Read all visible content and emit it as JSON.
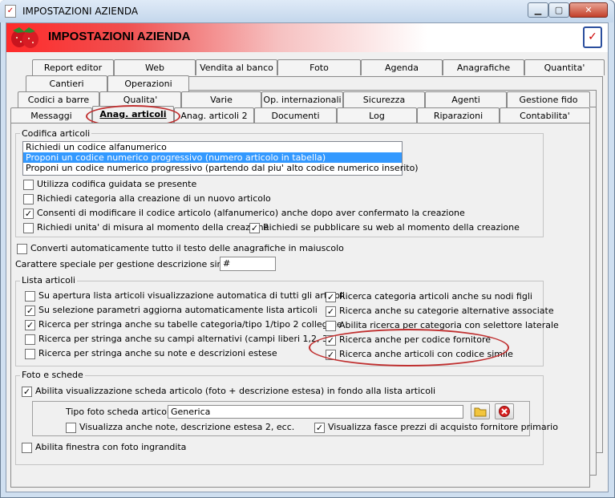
{
  "window": {
    "title": "IMPOSTAZIONI AZIENDA"
  },
  "header": {
    "title": "IMPOSTAZIONI AZIENDA"
  },
  "tabs": {
    "row1": [
      "Report editor",
      "Web",
      "Vendita al banco",
      "Foto",
      "Agenda",
      "Anagrafiche",
      "Quantita'"
    ],
    "row2": [
      "Cantieri",
      "Operazioni"
    ],
    "row3": [
      "Codici a barre",
      "Qualita'",
      "Varie",
      "Op. internazionali",
      "Sicurezza",
      "Agenti",
      "Gestione fido"
    ],
    "row4": [
      "Messaggi",
      "Anag. articoli",
      "Anag. articoli 2",
      "Documenti",
      "Log",
      "Riparazioni",
      "Contabilita'"
    ]
  },
  "codifica": {
    "title": "Codifica articoli",
    "options": [
      "Richiedi un codice alfanumerico",
      "Proponi un codice numerico progressivo (numero articolo in tabella)",
      "Proponi un codice numerico progressivo (partendo dal piu' alto codice numerico inserito)"
    ],
    "checks": [
      {
        "label": "Utilizza codifica guidata se presente",
        "checked": false
      },
      {
        "label": "Richiedi categoria alla creazione di un nuovo articolo",
        "checked": false
      },
      {
        "label": "Consenti di modificare il codice articolo (alfanumerico) anche dopo aver confermato la creazione",
        "checked": true
      },
      {
        "label": "Richiedi unita' di misura al momento della creazione",
        "checked": false
      },
      {
        "label": "Richiedi se pubblicare su web al momento della creazione",
        "checked": true
      }
    ]
  },
  "converti": {
    "label": "Converti automaticamente tutto il testo delle anagrafiche in maiuscolo",
    "checked": false
  },
  "carattere": {
    "label": "Carattere speciale per gestione descrizione sintetica :",
    "value": "#"
  },
  "lista": {
    "title": "Lista articoli",
    "left": [
      {
        "label": "Su apertura lista articoli visualizzazione automatica di tutti gli articoli",
        "checked": false
      },
      {
        "label": "Su selezione parametri aggiorna automaticamente lista articoli",
        "checked": true
      },
      {
        "label": "Ricerca per stringa anche su tabelle categoria/tipo 1/tipo 2 collegate",
        "checked": true
      },
      {
        "label": "Ricerca per stringa anche su campi alternativi (campi liberi 1,2, 3)",
        "checked": false
      },
      {
        "label": "Ricerca per stringa anche su note e descrizioni estese",
        "checked": false
      }
    ],
    "right": [
      {
        "label": "Ricerca categoria articoli anche su nodi figli",
        "checked": true
      },
      {
        "label": "Ricerca anche su categorie alternative associate",
        "checked": true
      },
      {
        "label": "Abilita ricerca per categoria con selettore laterale",
        "checked": false
      },
      {
        "label": "Ricerca anche per codice fornitore",
        "checked": true
      },
      {
        "label": "Ricerca anche articoli con codice simile",
        "checked": true
      }
    ]
  },
  "foto": {
    "title": "Foto e schede",
    "abilita": {
      "label": "Abilita visualizzazione scheda articolo (foto + descrizione estesa) in fondo alla lista articoli",
      "checked": true
    },
    "tipo_label": "Tipo foto scheda articolo :",
    "tipo_value": "Generica",
    "note": {
      "label": "Visualizza anche note, descrizione estesa 2, ecc.",
      "checked": false
    },
    "fasce": {
      "label": "Visualizza fasce prezzi di acquisto fornitore primario",
      "checked": true
    },
    "finestra": {
      "label": "Abilita finestra con foto ingrandita",
      "checked": false
    }
  },
  "icons": {
    "folder": "folder-icon",
    "delete": "delete-icon",
    "check": "checkmark"
  }
}
